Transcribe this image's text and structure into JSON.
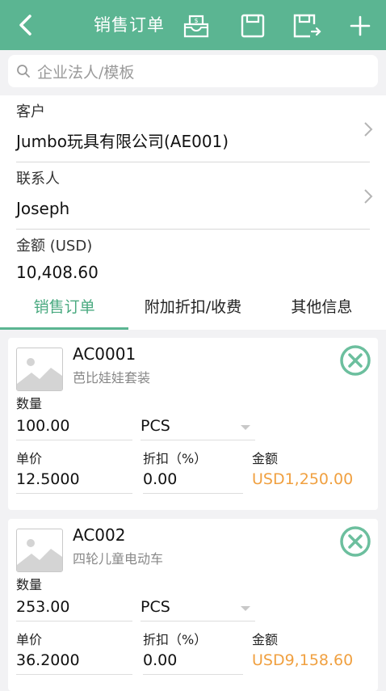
{
  "header": {
    "title": "销售订单",
    "background": "#5bb592"
  },
  "search": {
    "placeholder": "企业法人/模板"
  },
  "customer": {
    "label": "客户",
    "value": "Jumbo玩具有限公司(AE001)"
  },
  "contact": {
    "label": "联系人",
    "value": "Joseph"
  },
  "amount": {
    "label": "金额 (USD)",
    "value": "10,408.60"
  },
  "tabs": [
    {
      "label": "销售订单",
      "active": true
    },
    {
      "label": "附加折扣/收费",
      "active": false
    },
    {
      "label": "其他信息",
      "active": false
    }
  ],
  "items": [
    {
      "code": "AC0001",
      "name": "芭比娃娃套装",
      "qty_label": "数量",
      "qty": "100.00",
      "unit": "PCS",
      "price_label": "单价",
      "price": "12.5000",
      "discount_label": "折扣（%）",
      "discount": "0.00",
      "amount_label": "金额",
      "amount": "USD1,250.00"
    },
    {
      "code": "AC002",
      "name": "四轮儿童电动车",
      "qty_label": "数量",
      "qty": "253.00",
      "unit": "PCS",
      "price_label": "单价",
      "price": "36.2000",
      "discount_label": "折扣（%）",
      "discount": "0.00",
      "amount_label": "金额",
      "amount": "USD9,158.60"
    }
  ],
  "colors": {
    "accent": "#5bb592",
    "amount": "#f0a040"
  },
  "icons": [
    "back-arrow-icon",
    "payment-icon",
    "save-icon",
    "save-export-icon",
    "add-icon",
    "search-icon",
    "chevron-right-icon",
    "image-placeholder-icon",
    "remove-icon",
    "dropdown-icon"
  ]
}
